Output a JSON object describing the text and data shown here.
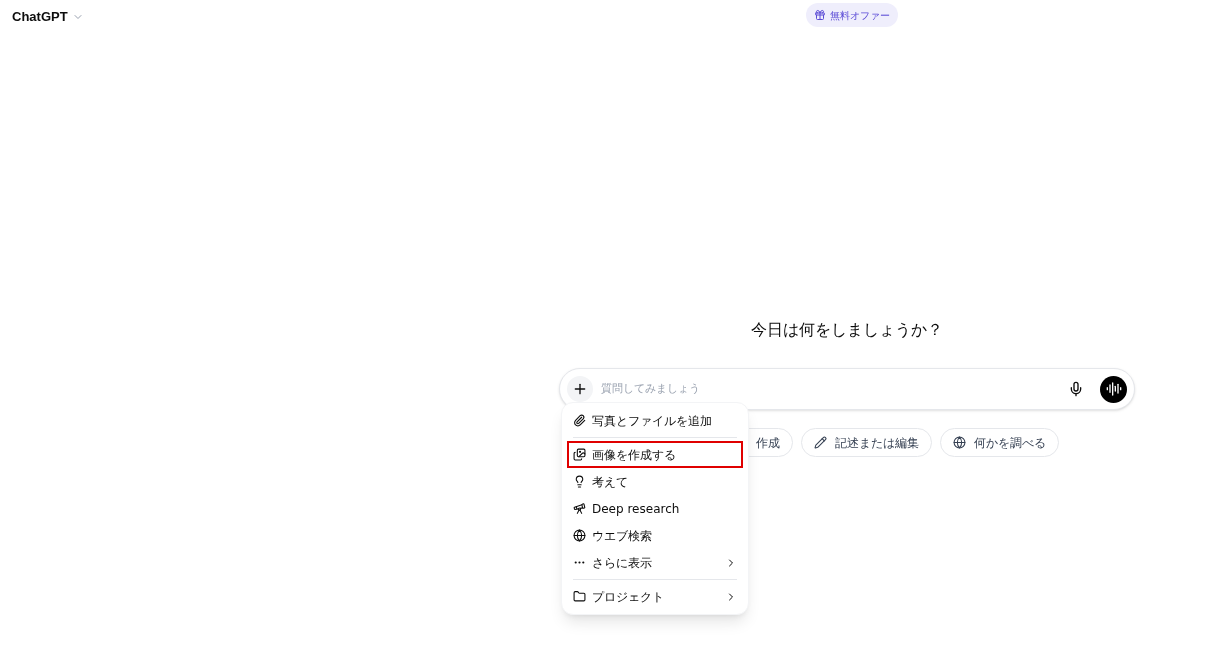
{
  "header": {
    "title": "ChatGPT",
    "offer": "無料オファー"
  },
  "heading": "今日は何をしましょうか？",
  "composer": {
    "placeholder": "質問してみましょう"
  },
  "chips": [
    {
      "label": "作成",
      "kind": "partial"
    },
    {
      "label": "記述または編集",
      "kind": "pencil"
    },
    {
      "label": "何かを調べる",
      "kind": "globe"
    }
  ],
  "menu": {
    "groups": [
      {
        "items": [
          {
            "label": "写真とファイルを追加",
            "kind": "clip",
            "highlighted": false,
            "submenu": false
          }
        ]
      },
      {
        "items": [
          {
            "label": "画像を作成する",
            "kind": "image",
            "highlighted": true,
            "submenu": false
          },
          {
            "label": "考えて",
            "kind": "bulb",
            "highlighted": false,
            "submenu": false
          },
          {
            "label": "Deep research",
            "kind": "telescope",
            "highlighted": false,
            "submenu": false
          },
          {
            "label": "ウエブ検索",
            "kind": "globe",
            "highlighted": false,
            "submenu": false
          },
          {
            "label": "さらに表示",
            "kind": "more",
            "highlighted": false,
            "submenu": true
          }
        ]
      },
      {
        "items": [
          {
            "label": "プロジェクト",
            "kind": "folder",
            "highlighted": false,
            "submenu": true
          }
        ]
      }
    ]
  }
}
